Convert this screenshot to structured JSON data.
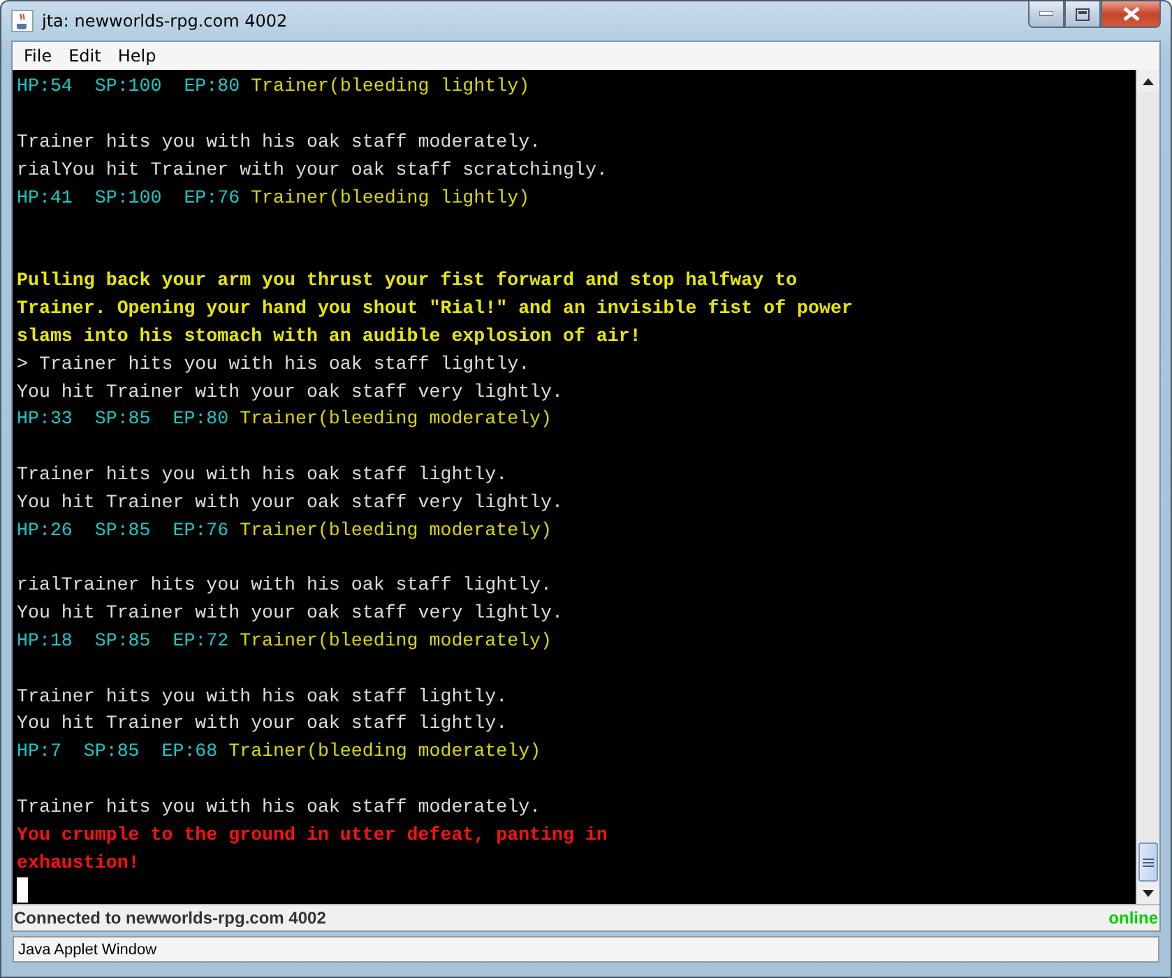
{
  "window": {
    "title": "jta: newworlds-rpg.com 4002"
  },
  "menu": [
    {
      "label": "File"
    },
    {
      "label": "Edit"
    },
    {
      "label": "Help"
    }
  ],
  "terminal": {
    "lines": [
      {
        "kind": "status",
        "stats": "HP:54  SP:100  EP:80",
        "target": "Trainer(bleeding lightly)"
      },
      {
        "kind": "blank"
      },
      {
        "kind": "plain",
        "text": "Trainer hits you with his oak staff moderately."
      },
      {
        "kind": "plain",
        "text": "rialYou hit Trainer with your oak staff scratchingly."
      },
      {
        "kind": "status",
        "stats": "HP:41  SP:100  EP:76",
        "target": "Trainer(bleeding lightly)"
      },
      {
        "kind": "blank"
      },
      {
        "kind": "blank"
      },
      {
        "kind": "emphasis",
        "text": "Pulling back your arm you thrust your fist forward and stop halfway to"
      },
      {
        "kind": "emphasis",
        "text": "Trainer. Opening your hand you shout \"Rial!\" and an invisible fist of power"
      },
      {
        "kind": "emphasis",
        "text": "slams into his stomach with an audible explosion of air!"
      },
      {
        "kind": "plain",
        "text": "> Trainer hits you with his oak staff lightly."
      },
      {
        "kind": "plain",
        "text": "You hit Trainer with your oak staff very lightly."
      },
      {
        "kind": "status",
        "stats": "HP:33  SP:85  EP:80",
        "target": "Trainer(bleeding moderately)"
      },
      {
        "kind": "blank"
      },
      {
        "kind": "plain",
        "text": "Trainer hits you with his oak staff lightly."
      },
      {
        "kind": "plain",
        "text": "You hit Trainer with your oak staff very lightly."
      },
      {
        "kind": "status",
        "stats": "HP:26  SP:85  EP:76",
        "target": "Trainer(bleeding moderately)"
      },
      {
        "kind": "blank"
      },
      {
        "kind": "plain",
        "text": "rialTrainer hits you with his oak staff lightly."
      },
      {
        "kind": "plain",
        "text": "You hit Trainer with your oak staff very lightly."
      },
      {
        "kind": "status",
        "stats": "HP:18  SP:85  EP:72",
        "target": "Trainer(bleeding moderately)"
      },
      {
        "kind": "blank"
      },
      {
        "kind": "plain",
        "text": "Trainer hits you with his oak staff lightly."
      },
      {
        "kind": "plain",
        "text": "You hit Trainer with your oak staff lightly."
      },
      {
        "kind": "status",
        "stats": "HP:7  SP:85  EP:68",
        "target": "Trainer(bleeding moderately)"
      },
      {
        "kind": "blank"
      },
      {
        "kind": "plain",
        "text": "Trainer hits you with his oak staff moderately."
      },
      {
        "kind": "alert",
        "text": "You crumple to the ground in utter defeat, panting in"
      },
      {
        "kind": "alert",
        "text": "exhaustion!"
      },
      {
        "kind": "cursor"
      }
    ]
  },
  "status_bar": {
    "connection": "Connected to newworlds-rpg.com 4002",
    "state": "online"
  },
  "applet_notice": "Java Applet Window"
}
